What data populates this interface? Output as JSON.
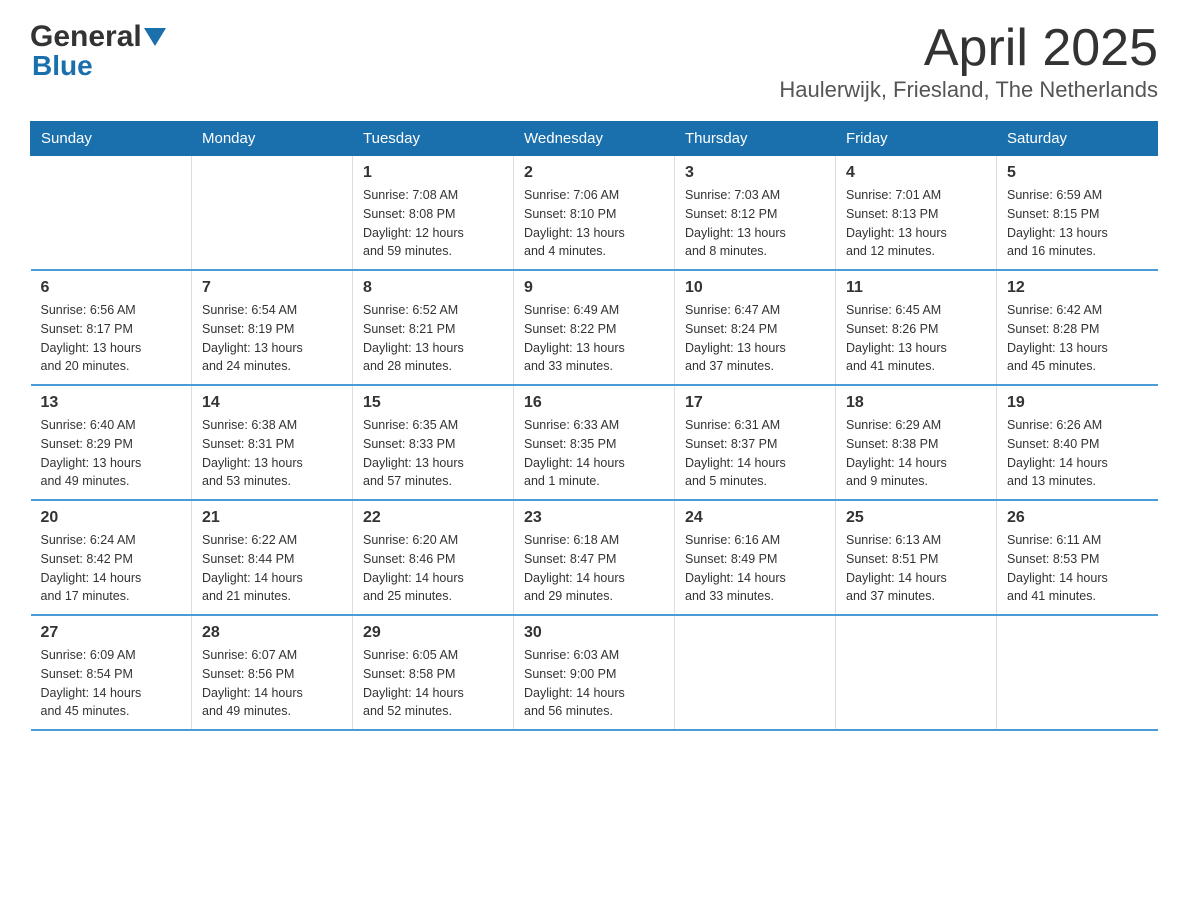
{
  "header": {
    "logo_general": "General",
    "logo_blue": "Blue",
    "title": "April 2025",
    "subtitle": "Haulerwijk, Friesland, The Netherlands"
  },
  "weekdays": [
    "Sunday",
    "Monday",
    "Tuesday",
    "Wednesday",
    "Thursday",
    "Friday",
    "Saturday"
  ],
  "weeks": [
    [
      {
        "day": "",
        "info": ""
      },
      {
        "day": "",
        "info": ""
      },
      {
        "day": "1",
        "info": "Sunrise: 7:08 AM\nSunset: 8:08 PM\nDaylight: 12 hours\nand 59 minutes."
      },
      {
        "day": "2",
        "info": "Sunrise: 7:06 AM\nSunset: 8:10 PM\nDaylight: 13 hours\nand 4 minutes."
      },
      {
        "day": "3",
        "info": "Sunrise: 7:03 AM\nSunset: 8:12 PM\nDaylight: 13 hours\nand 8 minutes."
      },
      {
        "day": "4",
        "info": "Sunrise: 7:01 AM\nSunset: 8:13 PM\nDaylight: 13 hours\nand 12 minutes."
      },
      {
        "day": "5",
        "info": "Sunrise: 6:59 AM\nSunset: 8:15 PM\nDaylight: 13 hours\nand 16 minutes."
      }
    ],
    [
      {
        "day": "6",
        "info": "Sunrise: 6:56 AM\nSunset: 8:17 PM\nDaylight: 13 hours\nand 20 minutes."
      },
      {
        "day": "7",
        "info": "Sunrise: 6:54 AM\nSunset: 8:19 PM\nDaylight: 13 hours\nand 24 minutes."
      },
      {
        "day": "8",
        "info": "Sunrise: 6:52 AM\nSunset: 8:21 PM\nDaylight: 13 hours\nand 28 minutes."
      },
      {
        "day": "9",
        "info": "Sunrise: 6:49 AM\nSunset: 8:22 PM\nDaylight: 13 hours\nand 33 minutes."
      },
      {
        "day": "10",
        "info": "Sunrise: 6:47 AM\nSunset: 8:24 PM\nDaylight: 13 hours\nand 37 minutes."
      },
      {
        "day": "11",
        "info": "Sunrise: 6:45 AM\nSunset: 8:26 PM\nDaylight: 13 hours\nand 41 minutes."
      },
      {
        "day": "12",
        "info": "Sunrise: 6:42 AM\nSunset: 8:28 PM\nDaylight: 13 hours\nand 45 minutes."
      }
    ],
    [
      {
        "day": "13",
        "info": "Sunrise: 6:40 AM\nSunset: 8:29 PM\nDaylight: 13 hours\nand 49 minutes."
      },
      {
        "day": "14",
        "info": "Sunrise: 6:38 AM\nSunset: 8:31 PM\nDaylight: 13 hours\nand 53 minutes."
      },
      {
        "day": "15",
        "info": "Sunrise: 6:35 AM\nSunset: 8:33 PM\nDaylight: 13 hours\nand 57 minutes."
      },
      {
        "day": "16",
        "info": "Sunrise: 6:33 AM\nSunset: 8:35 PM\nDaylight: 14 hours\nand 1 minute."
      },
      {
        "day": "17",
        "info": "Sunrise: 6:31 AM\nSunset: 8:37 PM\nDaylight: 14 hours\nand 5 minutes."
      },
      {
        "day": "18",
        "info": "Sunrise: 6:29 AM\nSunset: 8:38 PM\nDaylight: 14 hours\nand 9 minutes."
      },
      {
        "day": "19",
        "info": "Sunrise: 6:26 AM\nSunset: 8:40 PM\nDaylight: 14 hours\nand 13 minutes."
      }
    ],
    [
      {
        "day": "20",
        "info": "Sunrise: 6:24 AM\nSunset: 8:42 PM\nDaylight: 14 hours\nand 17 minutes."
      },
      {
        "day": "21",
        "info": "Sunrise: 6:22 AM\nSunset: 8:44 PM\nDaylight: 14 hours\nand 21 minutes."
      },
      {
        "day": "22",
        "info": "Sunrise: 6:20 AM\nSunset: 8:46 PM\nDaylight: 14 hours\nand 25 minutes."
      },
      {
        "day": "23",
        "info": "Sunrise: 6:18 AM\nSunset: 8:47 PM\nDaylight: 14 hours\nand 29 minutes."
      },
      {
        "day": "24",
        "info": "Sunrise: 6:16 AM\nSunset: 8:49 PM\nDaylight: 14 hours\nand 33 minutes."
      },
      {
        "day": "25",
        "info": "Sunrise: 6:13 AM\nSunset: 8:51 PM\nDaylight: 14 hours\nand 37 minutes."
      },
      {
        "day": "26",
        "info": "Sunrise: 6:11 AM\nSunset: 8:53 PM\nDaylight: 14 hours\nand 41 minutes."
      }
    ],
    [
      {
        "day": "27",
        "info": "Sunrise: 6:09 AM\nSunset: 8:54 PM\nDaylight: 14 hours\nand 45 minutes."
      },
      {
        "day": "28",
        "info": "Sunrise: 6:07 AM\nSunset: 8:56 PM\nDaylight: 14 hours\nand 49 minutes."
      },
      {
        "day": "29",
        "info": "Sunrise: 6:05 AM\nSunset: 8:58 PM\nDaylight: 14 hours\nand 52 minutes."
      },
      {
        "day": "30",
        "info": "Sunrise: 6:03 AM\nSunset: 9:00 PM\nDaylight: 14 hours\nand 56 minutes."
      },
      {
        "day": "",
        "info": ""
      },
      {
        "day": "",
        "info": ""
      },
      {
        "day": "",
        "info": ""
      }
    ]
  ]
}
